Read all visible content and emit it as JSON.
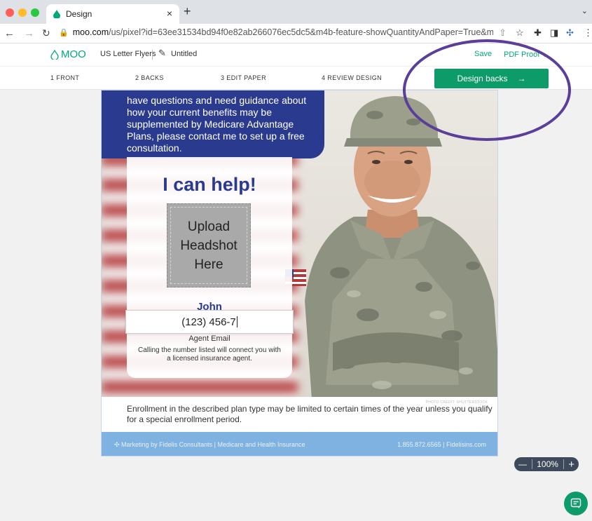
{
  "browser": {
    "tab_title": "Design",
    "url_host": "moo.com",
    "url_path": "/us/pixel?id=63ee31534bd94f0e82ab266076ec5dc5&m4b-feature-showQuantityAndPaper=True&m4b-feat..."
  },
  "header": {
    "logo": "MOO",
    "product": "US Letter Flyers",
    "doc_name": "Untitled",
    "save_label": "Save",
    "pdf_label": "PDF Proof"
  },
  "steps": [
    {
      "label": "1  FRONT"
    },
    {
      "label": "2  BACKS"
    },
    {
      "label": "3  EDIT PAPER"
    },
    {
      "label": "4  REVIEW DESIGN"
    }
  ],
  "cta": {
    "label": "Design backs",
    "arrow": "→"
  },
  "flyer": {
    "intro_text": "have questions and need guidance about how your current benefits may be supplemented by Medicare Advantage Plans, please contact me to set up a free consultation.",
    "help_title": "I can help!",
    "upload_text": "Upload Headshot Here",
    "agent_name": "John",
    "phone_value": "(123) 456-7",
    "agent_email": "Agent Email",
    "disclaimer": "Calling the number listed will connect you with a licensed insurance agent.",
    "photo_credit": "PHOTO CREDIT: SHUTTERSTOCK",
    "enrollment": "Enrollment in the described plan type may be limited to certain times of the year unless you qualify for a special enrollment period.",
    "footer_left": "Marketing by Fidelis Consultants | Medicare and Health Insurance",
    "footer_right": "1.855.872.6565 | Fidelisins.com"
  },
  "zoom": {
    "minus": "—",
    "level": "100%",
    "plus": "+"
  },
  "colors": {
    "brand_green": "#0e9b6a",
    "navy": "#2a3a8e",
    "annotation": "#5a3e9a"
  }
}
